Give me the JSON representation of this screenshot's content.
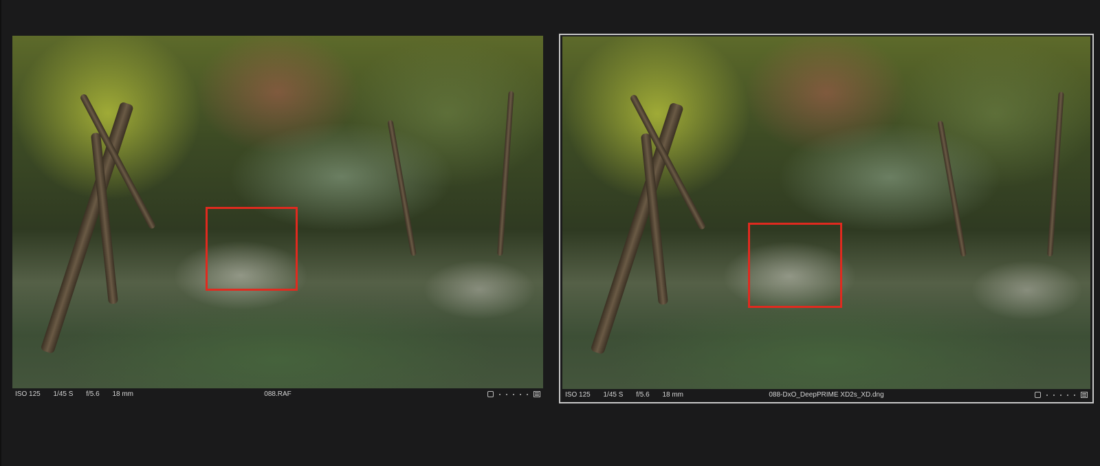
{
  "viewer": {
    "left": {
      "exif": {
        "iso": "ISO 125",
        "shutter": "1/45 S",
        "aperture": "f/5.6",
        "focal": "18 mm"
      },
      "filename": "088.RAF"
    },
    "right": {
      "exif": {
        "iso": "ISO 125",
        "shutter": "1/45 S",
        "aperture": "f/5.6",
        "focal": "18 mm"
      },
      "filename": "088-DxO_DeepPRIME XD2s_XD.dng",
      "selected": true
    },
    "colors": {
      "background": "#1a1a1b",
      "selection_border": "#c9c9c9",
      "roi": "#e02a1f"
    },
    "icons": [
      "pick-checkbox-icon",
      "rating-dots-icon",
      "list-view-icon"
    ]
  }
}
